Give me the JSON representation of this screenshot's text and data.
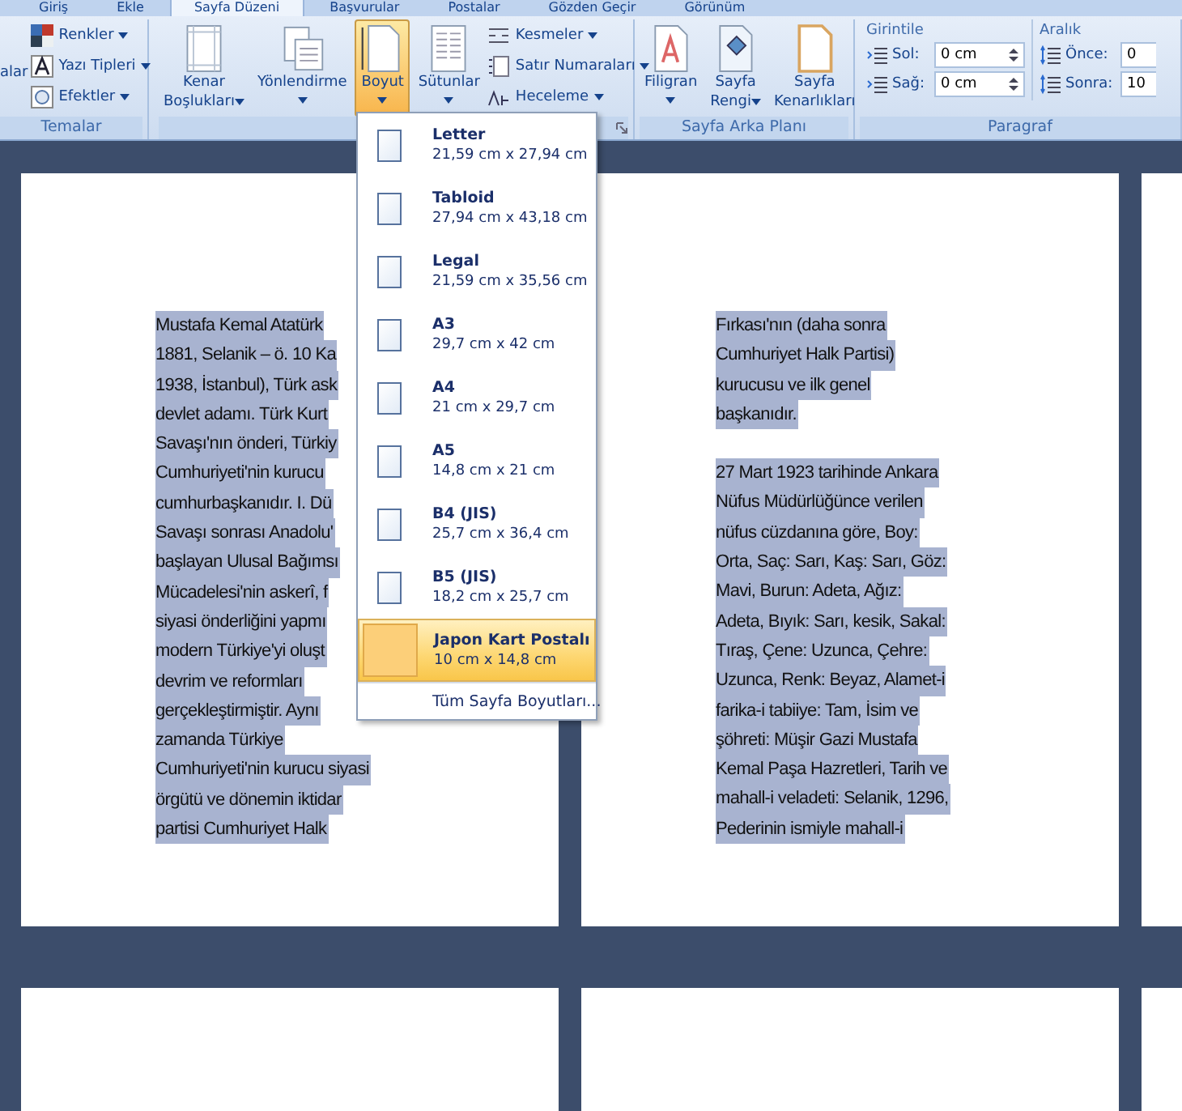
{
  "tabs": [
    {
      "label": "Giriş",
      "selected": false
    },
    {
      "label": "Ekle",
      "selected": false
    },
    {
      "label": "Sayfa Düzeni",
      "selected": true
    },
    {
      "label": "Başvurular",
      "selected": false
    },
    {
      "label": "Postalar",
      "selected": false
    },
    {
      "label": "Gözden Geçir",
      "selected": false
    },
    {
      "label": "Görünüm",
      "selected": false
    }
  ],
  "themes_group": {
    "cut_button": "alar",
    "items": [
      "Renkler",
      "Yazı Tipleri",
      "Efektler"
    ],
    "label": "Temalar"
  },
  "page_setup_group": {
    "large_buttons": [
      {
        "lines": [
          "Kenar",
          "Boşlukları"
        ],
        "selected": false
      },
      {
        "lines": [
          "Yönlendirme"
        ],
        "selected": false
      },
      {
        "lines": [
          "Boyut"
        ],
        "selected": true
      },
      {
        "lines": [
          "Sütunlar"
        ],
        "selected": false
      }
    ],
    "small_buttons": [
      "Kesmeler",
      "Satır Numaraları",
      "Heceleme"
    ]
  },
  "page_background_group": {
    "buttons": [
      {
        "lines": [
          "Filigran"
        ]
      },
      {
        "lines": [
          "Sayfa",
          "Rengi"
        ]
      },
      {
        "lines": [
          "Sayfa",
          "Kenarlıkları"
        ]
      }
    ],
    "label": "Sayfa Arka Planı"
  },
  "paragraph_group": {
    "label": "Paragraf",
    "indent": {
      "title": "Girintile",
      "fields": [
        {
          "label": "Sol:",
          "value": "0 cm"
        },
        {
          "label": "Sağ:",
          "value": "0 cm"
        }
      ]
    },
    "spacing": {
      "title": "Aralık",
      "fields": [
        {
          "label": "Önce:",
          "value": "0"
        },
        {
          "label": "Sonra:",
          "value": "10"
        }
      ]
    }
  },
  "size_menu": {
    "items": [
      {
        "name": "Letter",
        "size": "21,59 cm x 27,94 cm",
        "selected": false
      },
      {
        "name": "Tabloid",
        "size": "27,94 cm x 43,18 cm",
        "selected": false
      },
      {
        "name": "Legal",
        "size": "21,59 cm x 35,56 cm",
        "selected": false
      },
      {
        "name": "A3",
        "size": "29,7 cm x 42 cm",
        "selected": false
      },
      {
        "name": "A4",
        "size": "21 cm x 29,7 cm",
        "selected": false
      },
      {
        "name": "A5",
        "size": "14,8 cm x 21 cm",
        "selected": false
      },
      {
        "name": "B4 (JIS)",
        "size": "25,7 cm x 36,4 cm",
        "selected": false
      },
      {
        "name": "B5 (JIS)",
        "size": "18,2 cm x 25,7 cm",
        "selected": false
      },
      {
        "name": "Japon Kart Postalı",
        "size": "10 cm x 14,8 cm",
        "selected": true
      }
    ],
    "footer": "Tüm Sayfa Boyutları..."
  },
  "pages": [
    {
      "paragraphs": [
        [
          "Mustafa Kemal Atatürk",
          "1881, Selanik – ö. 10 Ka",
          "1938, İstanbul), Türk ask",
          "devlet adamı. Türk Kurt",
          "Savaşı'nın önderi, Türkiy",
          "Cumhuriyeti'nin kurucu",
          "cumhurbaşkanıdır. I. Dü",
          "Savaşı sonrası Anadolu'",
          "başlayan Ulusal Bağımsı",
          "Mücadelesi'nin askerî, f",
          "siyasi önderliğini yapmı",
          "modern Türkiye'yi oluşt",
          "devrim ve reformları",
          "gerçekleştirmiştir. Aynı",
          "zamanda Türkiye",
          "Cumhuriyeti'nin kurucu siyasi",
          "örgütü ve dönemin iktidar",
          "partisi Cumhuriyet Halk"
        ]
      ]
    },
    {
      "paragraphs": [
        [
          "Fırkası'nın (daha sonra",
          "Cumhuriyet Halk Partisi)",
          "kurucusu ve ilk genel",
          "başkanıdır."
        ],
        [
          "27 Mart 1923  tarihinde Ankara",
          "Nüfus Müdürlüğünce verilen",
          "nüfus cüzdanına göre, Boy:",
          "Orta, Saç: Sarı, Kaş: Sarı, Göz:",
          "Mavi, Burun: Adeta, Ağız:",
          "Adeta, Bıyık: Sarı, kesik, Sakal:",
          "Tıraş, Çene: Uzunca, Çehre:",
          "Uzunca, Renk: Beyaz, Alamet-i",
          "farika-i tabiiye: Tam, İsim ve",
          "şöhreti: Müşir Gazi Mustafa",
          "Kemal Paşa Hazretleri, Tarih ve",
          "mahall-i veladeti: Selanik, 1296,",
          "Pederinin ismiyle mahall-i"
        ]
      ]
    }
  ]
}
